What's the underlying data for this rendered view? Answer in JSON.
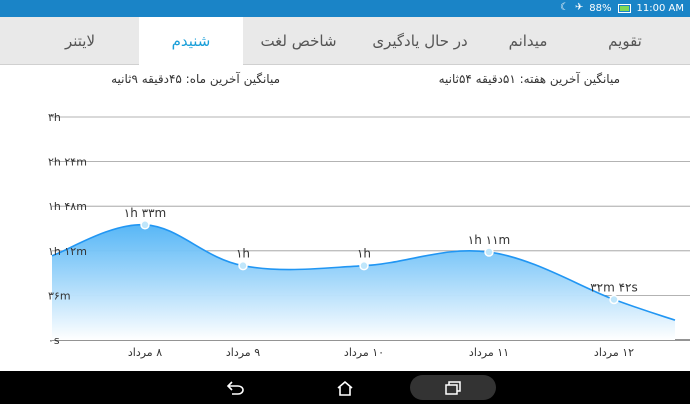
{
  "status_bar": {
    "battery": "88%",
    "time": "11:00 AM",
    "icons": [
      "moon-icon",
      "airplane-icon",
      "battery-icon"
    ]
  },
  "tabs": [
    {
      "label": "تقویم",
      "active": false
    },
    {
      "label": "میدانم",
      "active": false
    },
    {
      "label": "در حال یادگیری",
      "active": false
    },
    {
      "label": "شاخص لغت",
      "active": false
    },
    {
      "label": "شنیدم",
      "active": true
    },
    {
      "label": "لایتنر",
      "active": false
    }
  ],
  "averages": {
    "week": "میانگین آخرین هفته: ۵۱دقیقه  ۵۴ثانیه",
    "month": "میانگین آخرین ماه: ۴۵دقیقه  ۹ثانیه"
  },
  "colors": {
    "accent": "#1a9fd9",
    "status_bar": "#1a84c7",
    "line": "#2196f3",
    "fill_top": "#4fb3f6",
    "fill_bottom": "#ffffff"
  },
  "chart_data": {
    "type": "area",
    "categories": [
      "۸ مرداد",
      "۹ مرداد",
      "۱۰ مرداد",
      "۱۱ مرداد",
      "۱۲ مرداد"
    ],
    "values_minutes": [
      93,
      60,
      60,
      71,
      32.7
    ],
    "point_labels": [
      "۱h ۳۳m",
      "۱h",
      "۱h",
      "۱h ۱۱m",
      "۳۲m ۴۲s"
    ],
    "y_ticks": [
      {
        "value": 0,
        "label": "۰s"
      },
      {
        "value": 36,
        "label": "۳۶m"
      },
      {
        "value": 72,
        "label": "۱h ۱۲m"
      },
      {
        "value": 108,
        "label": "۱h ۴۸m"
      },
      {
        "value": 144,
        "label": "۲h ۲۴m"
      },
      {
        "value": 180,
        "label": "۳h"
      }
    ],
    "ylim": [
      0,
      180
    ],
    "grid": true
  },
  "nav": {
    "back": "back-icon",
    "home": "home-icon",
    "recents": "recents-icon"
  }
}
